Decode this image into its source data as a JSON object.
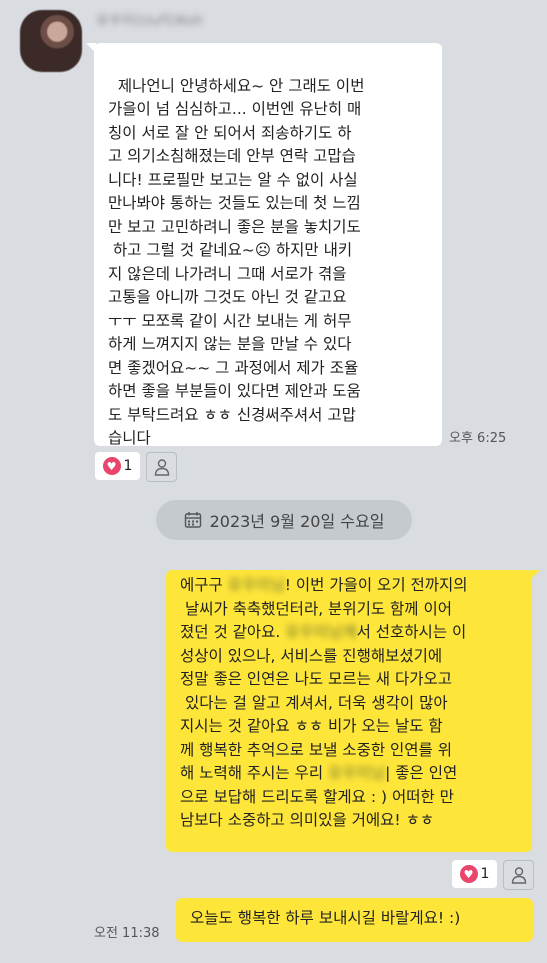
{
  "incoming": {
    "sender_name": "유우미(Uu미)Koh",
    "message": "제나언니 안녕하세요~ 안 그래도 이번\n가을이 넘 심심하고... 이번엔 유난히 매\n칭이 서로 잘 안 되어서 죄송하기도 하\n고 의기소침해졌는데 안부 연락 고맙습\n니다! 프로필만 보고는 알 수 없이 사실\n만나봐야 통하는 것들도 있는데 첫 느낌\n만 보고 고민하려니 좋은 분을 놓치기도\n 하고 그럴 것 같네요~☹ 하지만 내키\n지 않은데 나가려니 그때 서로가 겪을\n고통을 아니까 그것도 아닌 것 같고요\nㅜㅜ 모쪼록 같이 시간 보내는 게 허무\n하게 느껴지지 않는 분을 만날 수 있다\n면 좋겠어요~~ 그 과정에서 제가 조율\n하면 좋을 부분들이 있다면 제안과 도움\n도 부탁드려요 ㅎㅎ 신경써주셔서 고맙\n습니다",
    "time": "오후 6:25",
    "reaction_count": "1"
  },
  "date_divider": "2023년 9월 20일 수요일",
  "outgoing": [
    {
      "segments": [
        {
          "text": "에구구 ",
          "blur": false
        },
        {
          "text": "유우미님",
          "blur": true
        },
        {
          "text": "! 이번 가을이 오기 전까지의\n 날씨가 축축했던터라, 분위기도 함께 이어\n졌던 것 같아요. ",
          "blur": false
        },
        {
          "text": "유우미님께",
          "blur": true
        },
        {
          "text": "서 선호하시는 이\n성상이 있으나, 서비스를 진행해보셨기에\n정말 좋은 인연은 나도 모르는 새 다가오고\n 있다는 걸 알고 계셔서, 더욱 생각이 많아\n지시는 것 같아요 ㅎㅎ 비가 오는 날도 함\n께 행복한 추억으로 보낼 소중한 인연를 위\n해 노력해 주시는 우리 ",
          "blur": false
        },
        {
          "text": "유우미님",
          "blur": true
        },
        {
          "text": "| 좋은 인연\n으로 보답해 드리도록 할게요 : ) 어떠한 만\n남보다 소중하고 의미있을 거에요! ㅎㅎ",
          "blur": false
        }
      ],
      "reaction_count": "1"
    },
    {
      "text": "오늘도 행복한 하루 보내시길 바랄게요! :)",
      "time": "오전 11:38"
    }
  ],
  "colors": {
    "background": "#d9dde2",
    "incoming_bubble": "#ffffff",
    "outgoing_bubble": "#fde53a",
    "heart": "#e8466c"
  },
  "icons": [
    "heart-icon",
    "person-icon",
    "calendar-icon"
  ]
}
